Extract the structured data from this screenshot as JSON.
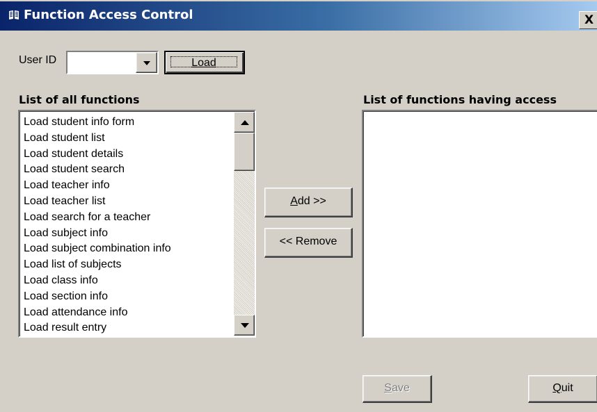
{
  "window": {
    "title": "Function Access Control",
    "close_glyph": "X",
    "icon": "book-icon",
    "colors": {
      "face": "#d4d0c8",
      "titlebar_start": "#0a246a",
      "titlebar_end": "#a6caf0",
      "title_text": "#ffffff",
      "disabled_text": "#808080"
    }
  },
  "user": {
    "label": "User ID",
    "value": "",
    "load_button": "Load"
  },
  "all_functions": {
    "label": "List of all functions",
    "items": [
      "Load student info form",
      "Load student list",
      "Load student details",
      "Load student search",
      "Load teacher info",
      "Load teacher list",
      "Load search for a teacher",
      "Load subject info",
      "Load subject combination info",
      "Load list of subjects",
      "Load class info",
      "Load section info",
      "Load attendance info",
      "Load result entry"
    ]
  },
  "access_functions": {
    "label": "List of functions having access",
    "items": []
  },
  "buttons": {
    "add_mnemonic": "A",
    "add_rest": "dd >>",
    "remove": "<< Remove",
    "save_mnemonic": "S",
    "save_rest": "ave",
    "save_enabled": false,
    "quit_mnemonic": "Q",
    "quit_rest": "uit"
  }
}
